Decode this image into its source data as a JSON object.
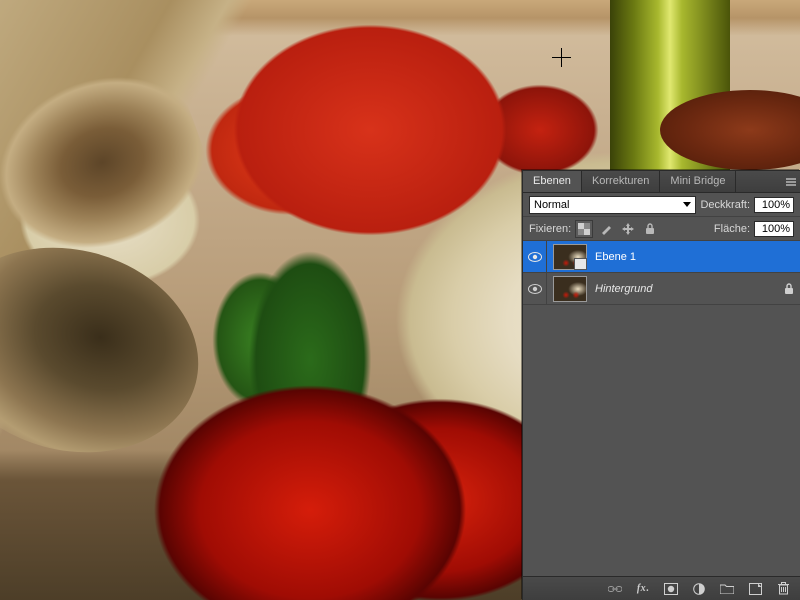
{
  "panel": {
    "tabs": [
      {
        "label": "Ebenen",
        "active": true
      },
      {
        "label": "Korrekturen",
        "active": false
      },
      {
        "label": "Mini Bridge",
        "active": false
      }
    ],
    "blend_mode": "Normal",
    "opacity_label": "Deckkraft:",
    "opacity_value": "100%",
    "lock_label": "Fixieren:",
    "fill_label": "Fläche:",
    "fill_value": "100%",
    "layers": [
      {
        "name": "Ebene 1",
        "selected": true,
        "smart": true,
        "locked": false
      },
      {
        "name": "Hintergrund",
        "selected": false,
        "smart": false,
        "locked": true
      }
    ]
  },
  "footer_icons": [
    "link-icon",
    "fx-icon",
    "mask-icon",
    "adjustment-icon",
    "group-icon",
    "new-layer-icon",
    "trash-icon"
  ]
}
